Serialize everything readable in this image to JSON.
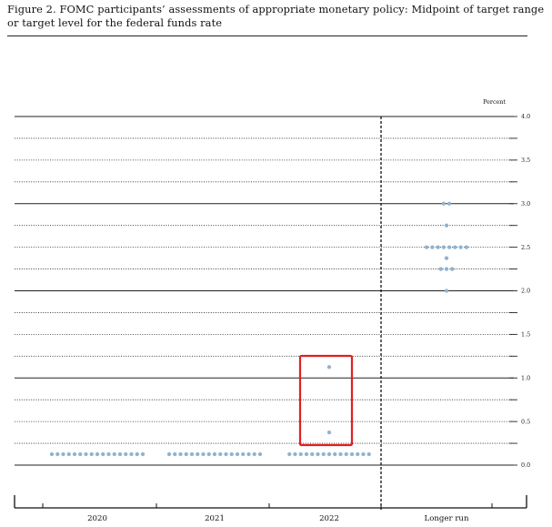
{
  "figure": {
    "title": "Figure 2.  FOMC participants’ assessments of appropriate monetary policy: Midpoint of target range or target level for the federal funds rate"
  },
  "chart_data": {
    "type": "scatter",
    "title": "Figure 2.  FOMC participants’ assessments of appropriate monetary policy: Midpoint of target range or target level for the federal funds rate",
    "ylabel": "Percent",
    "ylim": [
      0.0,
      4.0
    ],
    "y_step": 0.25,
    "y_tick_labels": [
      "0.0",
      "0.5",
      "1.0",
      "1.5",
      "2.0",
      "2.5",
      "3.0",
      "3.5",
      "4.0"
    ],
    "categories": [
      "2020",
      "2021",
      "2022",
      "Longer run"
    ],
    "grid": true,
    "dot_color": "#8fb3d1",
    "highlight_color": "#e02020",
    "highlight_category": "2022",
    "points": [
      {
        "x": "2020",
        "y": 0.125,
        "count": 17
      },
      {
        "x": "2021",
        "y": 0.125,
        "count": 17
      },
      {
        "x": "2022",
        "y": 0.125,
        "count": 15
      },
      {
        "x": "2022",
        "y": 0.375,
        "count": 1
      },
      {
        "x": "2022",
        "y": 1.125,
        "count": 1
      },
      {
        "x": "Longer run",
        "y": 2.0,
        "count": 1
      },
      {
        "x": "Longer run",
        "y": 2.25,
        "count": 3
      },
      {
        "x": "Longer run",
        "y": 2.375,
        "count": 1
      },
      {
        "x": "Longer run",
        "y": 2.5,
        "count": 8
      },
      {
        "x": "Longer run",
        "y": 2.75,
        "count": 1
      },
      {
        "x": "Longer run",
        "y": 3.0,
        "count": 2
      }
    ]
  }
}
